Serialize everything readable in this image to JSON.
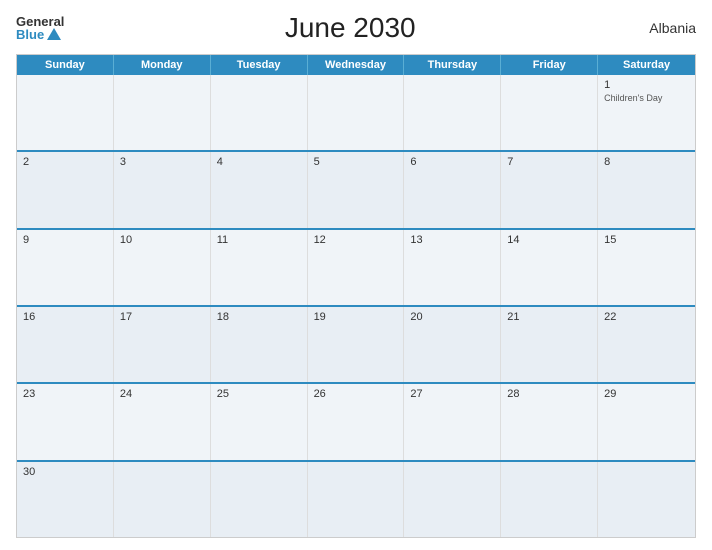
{
  "header": {
    "logo_general": "General",
    "logo_blue": "Blue",
    "title": "June 2030",
    "country": "Albania"
  },
  "calendar": {
    "day_headers": [
      "Sunday",
      "Monday",
      "Tuesday",
      "Wednesday",
      "Thursday",
      "Friday",
      "Saturday"
    ],
    "weeks": [
      [
        {
          "day": "",
          "event": ""
        },
        {
          "day": "",
          "event": ""
        },
        {
          "day": "",
          "event": ""
        },
        {
          "day": "",
          "event": ""
        },
        {
          "day": "",
          "event": ""
        },
        {
          "day": "",
          "event": ""
        },
        {
          "day": "1",
          "event": "Children's Day"
        }
      ],
      [
        {
          "day": "2",
          "event": ""
        },
        {
          "day": "3",
          "event": ""
        },
        {
          "day": "4",
          "event": ""
        },
        {
          "day": "5",
          "event": ""
        },
        {
          "day": "6",
          "event": ""
        },
        {
          "day": "7",
          "event": ""
        },
        {
          "day": "8",
          "event": ""
        }
      ],
      [
        {
          "day": "9",
          "event": ""
        },
        {
          "day": "10",
          "event": ""
        },
        {
          "day": "11",
          "event": ""
        },
        {
          "day": "12",
          "event": ""
        },
        {
          "day": "13",
          "event": ""
        },
        {
          "day": "14",
          "event": ""
        },
        {
          "day": "15",
          "event": ""
        }
      ],
      [
        {
          "day": "16",
          "event": ""
        },
        {
          "day": "17",
          "event": ""
        },
        {
          "day": "18",
          "event": ""
        },
        {
          "day": "19",
          "event": ""
        },
        {
          "day": "20",
          "event": ""
        },
        {
          "day": "21",
          "event": ""
        },
        {
          "day": "22",
          "event": ""
        }
      ],
      [
        {
          "day": "23",
          "event": ""
        },
        {
          "day": "24",
          "event": ""
        },
        {
          "day": "25",
          "event": ""
        },
        {
          "day": "26",
          "event": ""
        },
        {
          "day": "27",
          "event": ""
        },
        {
          "day": "28",
          "event": ""
        },
        {
          "day": "29",
          "event": ""
        }
      ],
      [
        {
          "day": "30",
          "event": ""
        },
        {
          "day": "",
          "event": ""
        },
        {
          "day": "",
          "event": ""
        },
        {
          "day": "",
          "event": ""
        },
        {
          "day": "",
          "event": ""
        },
        {
          "day": "",
          "event": ""
        },
        {
          "day": "",
          "event": ""
        }
      ]
    ]
  }
}
